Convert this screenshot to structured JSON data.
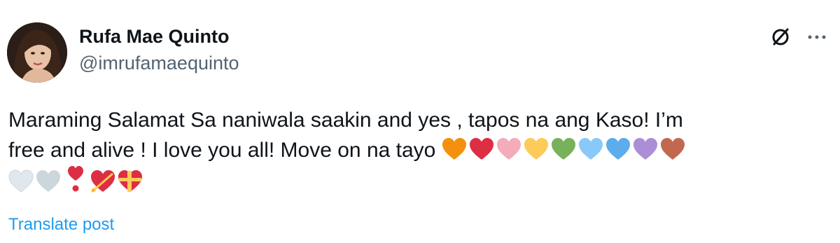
{
  "author": {
    "name": "Rufa Mae Quinto",
    "handle": "@imrufamaequinto"
  },
  "tweet": {
    "line1": "Maraming Salamat Sa naniwala saakin and yes , tapos na ang Kaso! I’m",
    "line2": "free and alive ! I love you all! Move on na tayo",
    "emojis": [
      {
        "name": "orange-heart-icon",
        "color": "#f4900c"
      },
      {
        "name": "red-heart-icon",
        "color": "#dd2e44"
      },
      {
        "name": "pink-heart-icon",
        "color": "#f4abba"
      },
      {
        "name": "yellow-heart-icon",
        "color": "#fdcb58"
      },
      {
        "name": "green-heart-icon",
        "color": "#78b159"
      },
      {
        "name": "light-blue-heart-icon",
        "color": "#88c9f9"
      },
      {
        "name": "blue-heart-icon",
        "color": "#5dadec"
      },
      {
        "name": "purple-heart-icon",
        "color": "#aa8ed6"
      },
      {
        "name": "brown-heart-icon",
        "color": "#c1694f"
      },
      {
        "name": "white-heart-icon",
        "color": "#e1e8ed"
      },
      {
        "name": "grey-heart-icon",
        "color": "#ccd6dd"
      },
      {
        "name": "exclamation-heart-icon",
        "color": "#dd2e44"
      },
      {
        "name": "heart-with-arrow-icon",
        "color": "#dd2e44"
      },
      {
        "name": "heart-with-ribbon-icon",
        "color": "#dd2e44"
      }
    ]
  },
  "translate_label": "Translate post",
  "actions": {
    "grok_icon": "grok-icon",
    "more_icon": "more-options-icon"
  }
}
